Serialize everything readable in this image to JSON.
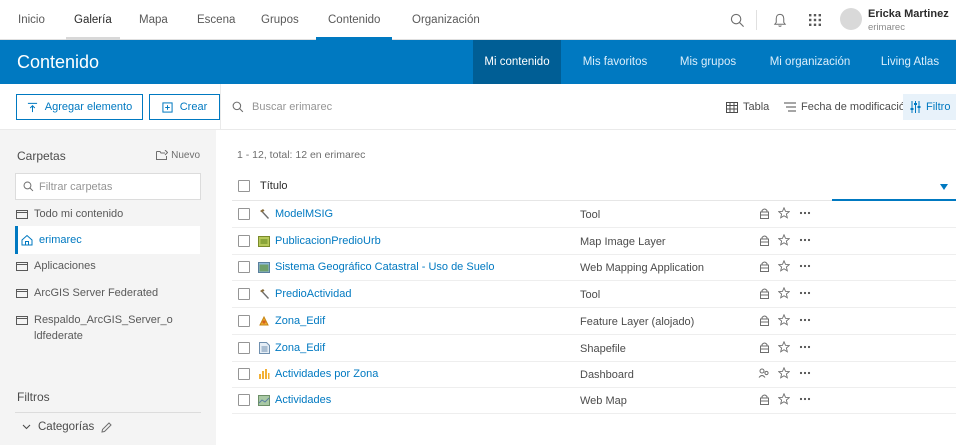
{
  "nav": {
    "links": [
      "Inicio",
      "Galería",
      "Mapa",
      "Escena",
      "Grupos",
      "Contenido",
      "Organización"
    ],
    "user_name": "Ericka Martinez",
    "user_id": "erimarec"
  },
  "header": {
    "title": "Contenido",
    "tabs": [
      "Mi contenido",
      "Mis favoritos",
      "Mis grupos",
      "Mi organización",
      "Living Atlas"
    ]
  },
  "toolbar": {
    "add_label": "Agregar elemento",
    "create_label": "Crear",
    "search_placeholder": "Buscar erimarec",
    "view_label": "Tabla",
    "sort_label": "Fecha de modificación",
    "filter_label": "Filtro"
  },
  "sidebar": {
    "folders_title": "Carpetas",
    "new_label": "Nuevo",
    "filter_placeholder": "Filtrar carpetas",
    "folders": [
      {
        "label": "Todo mi contenido"
      },
      {
        "label": "erimarec"
      },
      {
        "label": "Aplicaciones"
      },
      {
        "label": "ArcGIS Server Federated"
      },
      {
        "label": "Respaldo_ArcGIS_Server_o ldfederate"
      }
    ],
    "filters_title": "Filtros",
    "categories_label": "Categorías"
  },
  "list": {
    "summary": "1 - 12, total: 12 en erimarec",
    "column_title": "Título",
    "rows": [
      {
        "name": "ModelMSIG",
        "type": "Tool",
        "icon": "hammer-icon"
      },
      {
        "name": "PublicacionPredioUrb",
        "type": "Map Image Layer",
        "icon": "map-image-layer-icon"
      },
      {
        "name": "Sistema Geográfico Catastral - Uso de Suelo",
        "type": "Web Mapping Application",
        "icon": "web-app-icon"
      },
      {
        "name": "PredioActividad",
        "type": "Tool",
        "icon": "hammer-icon"
      },
      {
        "name": "Zona_Edif",
        "type": "Feature Layer (alojado)",
        "icon": "feature-layer-icon"
      },
      {
        "name": "Zona_Edif",
        "type": "Shapefile",
        "icon": "shapefile-icon"
      },
      {
        "name": "Actividades por Zona",
        "type": "Dashboard",
        "icon": "dashboard-icon"
      },
      {
        "name": "Actividades",
        "type": "Web Map",
        "icon": "web-map-icon"
      }
    ]
  },
  "colors": {
    "accent": "#0079c1",
    "header_bg": "#0079c1",
    "active_tab_bg": "#005e95"
  }
}
